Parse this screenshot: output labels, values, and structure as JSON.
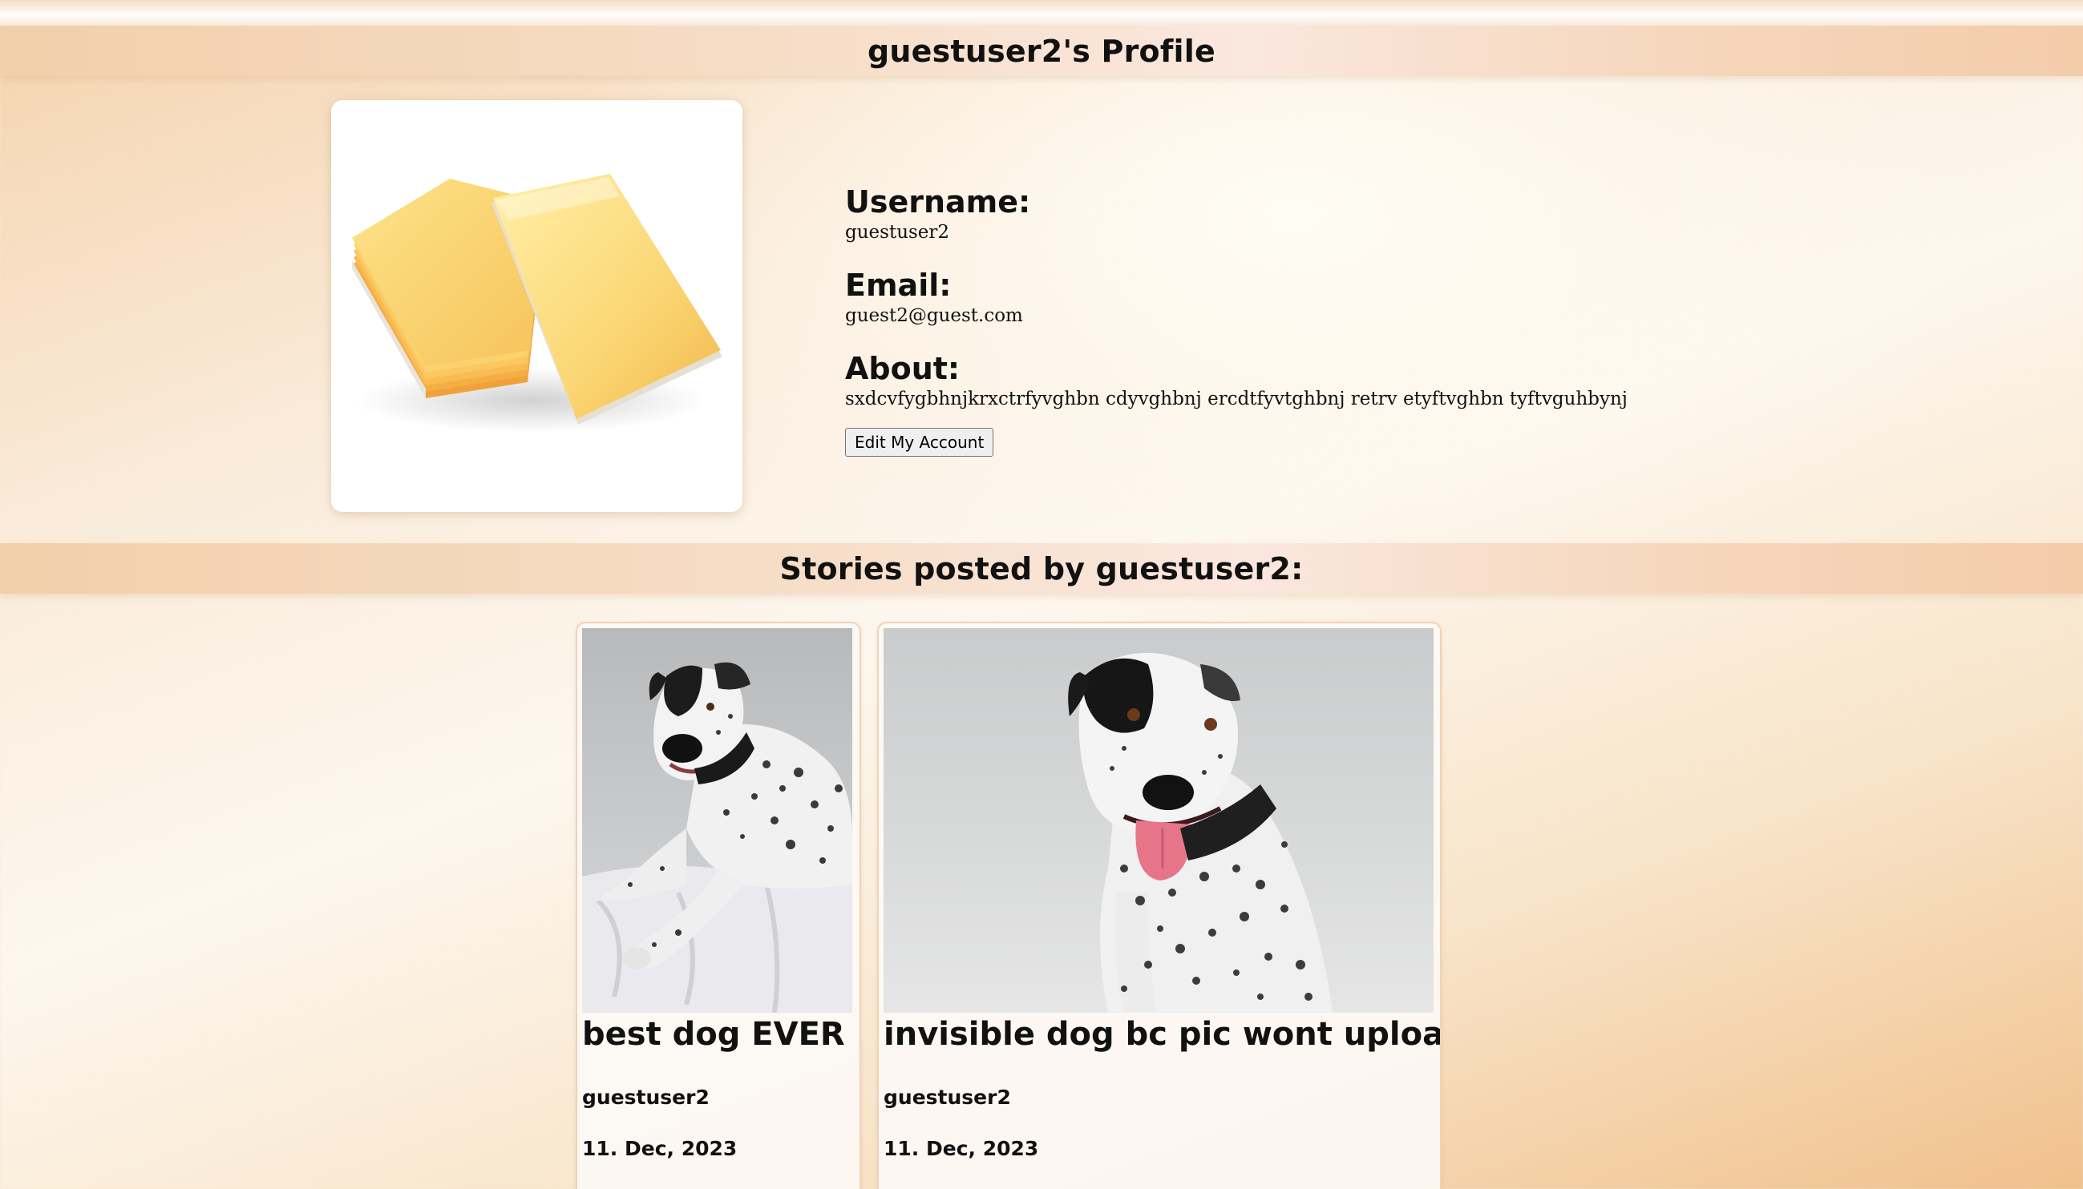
{
  "profile": {
    "title": "guestuser2's Profile",
    "username_label": "Username:",
    "username": "guestuser2",
    "email_label": "Email:",
    "email": "guest2@guest.com",
    "about_label": "About:",
    "about": "sxdcvfygbhnjkrxctrfyvghbn cdyvghbnj ercdtfyvtghbnj retrv etyftvghbn tyftvguhbynj",
    "edit_button": "Edit My Account",
    "avatar_icon": "cheese-slices-image"
  },
  "stories": {
    "heading": "Stories posted by guestuser2:",
    "items": [
      {
        "title": "best dog EVER",
        "author": "guestuser2",
        "date": "11. Dec, 2023",
        "image_icon": "dalmatian-dog-lying-image"
      },
      {
        "title": "invisible dog bc pic wont upload",
        "author": "guestuser2",
        "date": "11. Dec, 2023",
        "image_icon": "dalmatian-dog-sitting-image"
      }
    ]
  },
  "colors": {
    "band": "#f6dcc4",
    "card_border": "#f0d3b6",
    "text": "#111111"
  }
}
